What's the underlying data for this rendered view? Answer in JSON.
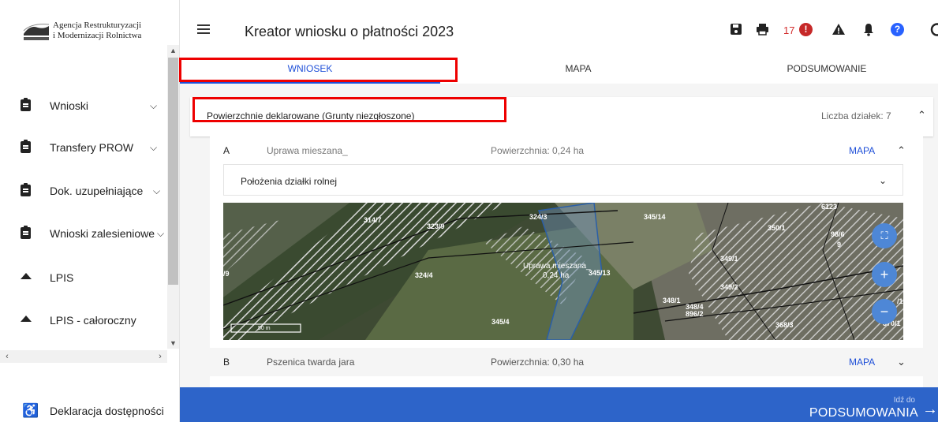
{
  "logo": {
    "line1": "Agencja Restrukturyzacji",
    "line2": "i Modernizacji Rolnictwa"
  },
  "sidebar": {
    "items": [
      {
        "label": "Wnioski",
        "icon": "clipboard-icon",
        "has_chevron": true
      },
      {
        "label": "Transfery PROW",
        "icon": "clipboard-icon",
        "has_chevron": true
      },
      {
        "label": "Dok. uzupełniające",
        "icon": "clipboard-icon",
        "has_chevron": true
      },
      {
        "label": "Wnioski zalesieniowe",
        "icon": "clipboard-icon",
        "has_chevron": true
      },
      {
        "label": "LPIS",
        "icon": "mountain-icon",
        "has_chevron": false
      },
      {
        "label": "LPIS - całoroczny",
        "icon": "mountain-icon",
        "has_chevron": false
      }
    ],
    "accessibility_label": "Deklaracja dostępności"
  },
  "header": {
    "title": "Kreator wniosku o płatności 2023",
    "alert_count": "17"
  },
  "tabs": [
    {
      "label": "WNIOSEK",
      "active": true
    },
    {
      "label": "MAPA",
      "active": false
    },
    {
      "label": "PODSUMOWANIE",
      "active": false
    }
  ],
  "section": {
    "title": "Powierzchnie deklarowane (Grunty niezgłoszone)",
    "count_label": "Liczba działek: 7"
  },
  "parcels": [
    {
      "letter": "A",
      "crop": "Uprawa mieszana_",
      "area": "Powierzchnia: 0,24 ha",
      "map_link": "MAPA",
      "expanded": true
    },
    {
      "letter": "B",
      "crop": "Pszenica twarda jara",
      "area": "Powierzchnia: 0,30 ha",
      "map_link": "MAPA",
      "expanded": false
    }
  ],
  "location_panel": {
    "label": "Położenia działki rolnej"
  },
  "map": {
    "parcel_labels": [
      "314/7",
      "323/9",
      "324/3",
      "345/14",
      "350/1",
      "98/6",
      "9",
      "324/4",
      "345/13",
      "349/1",
      "349/2",
      "348/1",
      "348/4",
      "896/2",
      "345/4",
      "368/3",
      "370/1",
      "6123",
      "/9",
      "/1"
    ],
    "highlight_label": "Uprawa mieszana_",
    "highlight_area": "0,24 ha",
    "scale": "50 m"
  },
  "footer": {
    "small": "Idź do",
    "big": "PODSUMOWANIA"
  },
  "colors": {
    "accent": "#2d64c9",
    "tab_active": "#1e4fd8",
    "alert": "#c62828",
    "highlight_box": "#ee0000"
  }
}
